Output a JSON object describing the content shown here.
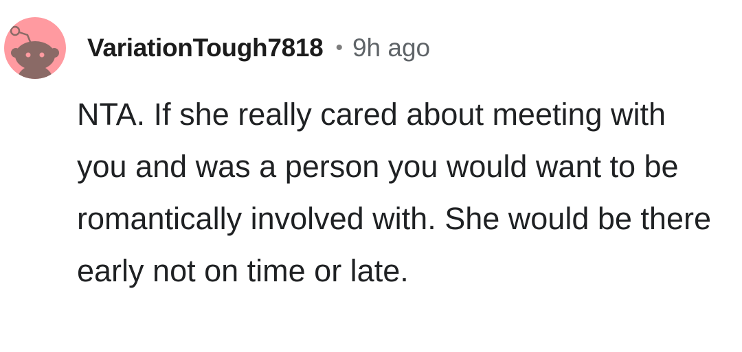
{
  "comment": {
    "author": "VariationTough7818",
    "separator": "•",
    "timestamp": "9h ago",
    "body": "NTA. If she really cared about meeting with you and was a person you would want to be romantically involved with. She would be there early not on time or late.",
    "avatar": {
      "icon": "snoo-avatar-icon",
      "background_color": "#ff9aa0",
      "figure_color": "#8a6a66"
    }
  }
}
